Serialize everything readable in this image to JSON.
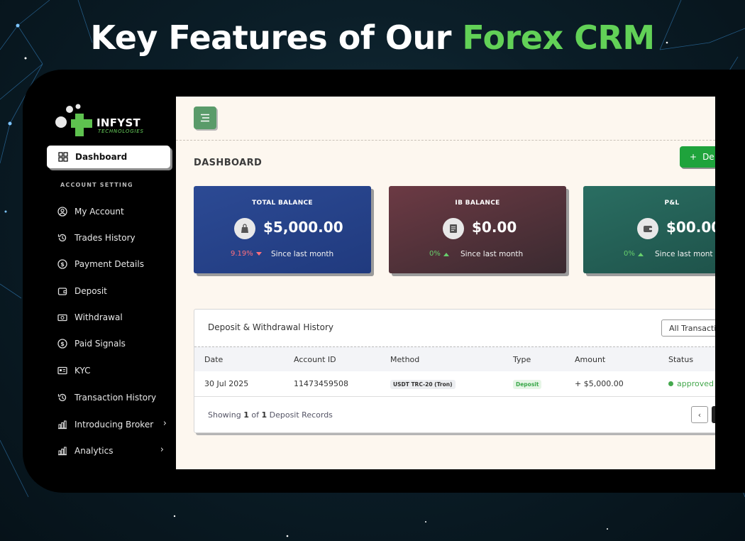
{
  "headline": {
    "prefix": "Key Features of Our",
    "accent": "Forex CRM"
  },
  "brand": {
    "name": "INFYST",
    "tagline": "TECHNOLOGIES"
  },
  "sidebar": {
    "active": {
      "label": "Dashboard",
      "icon": "grid-icon"
    },
    "section": "ACCOUNT SETTING",
    "items": [
      {
        "label": "My Account",
        "icon": "user-circle-icon"
      },
      {
        "label": "Trades History",
        "icon": "history-icon"
      },
      {
        "label": "Payment Details",
        "icon": "dollar-circle-icon"
      },
      {
        "label": "Deposit",
        "icon": "wallet-icon"
      },
      {
        "label": "Withdrawal",
        "icon": "cash-icon"
      },
      {
        "label": "Paid Signals",
        "icon": "dollar-circle-icon"
      },
      {
        "label": "KYC",
        "icon": "id-card-icon"
      },
      {
        "label": "Transaction History",
        "icon": "history-icon"
      },
      {
        "label": "Introducing Broker",
        "icon": "bar-chart-icon",
        "chevron": "›"
      },
      {
        "label": "Analytics",
        "icon": "bar-chart-icon",
        "chevron": "›"
      }
    ]
  },
  "main": {
    "title": "DASHBOARD",
    "action_label": "De",
    "action_icon": "+",
    "cards": [
      {
        "title": "TOTAL BALANCE",
        "value": "$5,000.00",
        "change": "9.19%",
        "trend": "down",
        "since": "Since last month",
        "icon": "bag-icon"
      },
      {
        "title": "IB BALANCE",
        "value": "$0.00",
        "change": "0%",
        "trend": "up",
        "since": "Since last month",
        "icon": "ledger-icon"
      },
      {
        "title": "P&L",
        "value": "$00.00",
        "change": "0%",
        "trend": "up",
        "since": "Since last mont",
        "icon": "wallet-icon"
      }
    ],
    "history": {
      "title": "Deposit & Withdrawal History",
      "filter": "All Transacti",
      "columns": [
        "Date",
        "Account ID",
        "Method",
        "Type",
        "Amount",
        "Status"
      ],
      "rows": [
        {
          "date": "30 Jul 2025",
          "account_id": "11473459508",
          "method": "USDT TRC-20 (Tron)",
          "type": "Deposit",
          "amount": "+ $5,000.00",
          "status": "approved"
        }
      ],
      "footer": {
        "prefix": "Showing",
        "current": "1",
        "middle": "of",
        "total": "1",
        "suffix": "Deposit Records"
      },
      "pager_prev": "‹"
    }
  },
  "colors": {
    "accent_green": "#62d157",
    "card_blue": "#2c4a94",
    "card_maroon": "#6c3a44",
    "card_teal": "#2a6e62"
  }
}
